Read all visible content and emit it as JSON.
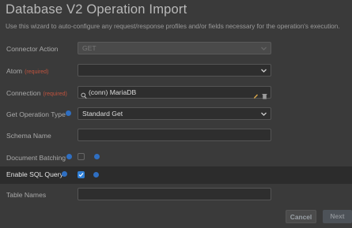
{
  "dialog": {
    "title": "Database V2 Operation Import",
    "subtitle": "Use this wizard to auto-configure any request/response profiles and/or fields necessary for the operation's execution."
  },
  "fields": {
    "connector_action": {
      "label": "Connector Action",
      "value": "GET"
    },
    "atom": {
      "label": "Atom",
      "required": "(required)",
      "value": ""
    },
    "connection": {
      "label": "Connection",
      "required": "(required)",
      "value": "(conn) MariaDB"
    },
    "operation_type": {
      "label": "Get Operation Type",
      "value": "Standard Get"
    },
    "schema_name": {
      "label": "Schema Name",
      "value": ""
    },
    "document_batching": {
      "label": "Document Batching",
      "checked": false
    },
    "enable_sql_query": {
      "label": "Enable SQL Query",
      "checked": true
    },
    "table_names": {
      "label": "Table Names",
      "value": ""
    }
  },
  "buttons": {
    "cancel": "Cancel",
    "next": "Next"
  },
  "colors": {
    "background": "#3a3a3a",
    "accent": "#2f7fd6",
    "required": "#c0533e"
  },
  "icons": [
    "search-icon",
    "edit-icon",
    "delete-icon",
    "chevron-down-icon",
    "info-icon",
    "check-icon"
  ]
}
